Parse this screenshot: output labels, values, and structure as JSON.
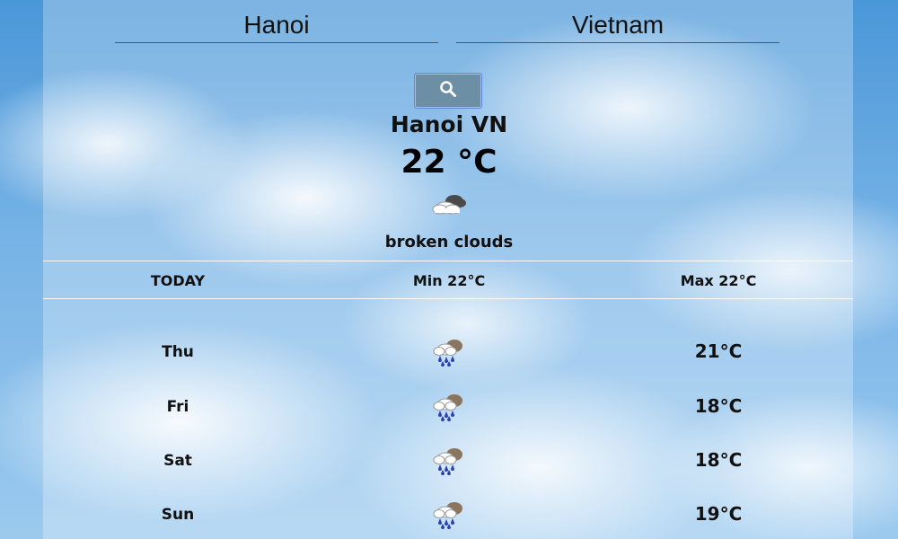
{
  "search": {
    "city_value": "Hanoi",
    "country_value": "Vietnam",
    "button_icon": "search-icon"
  },
  "current": {
    "location": "Hanoi VN",
    "temperature": "22 °C",
    "icon": "broken-clouds-icon",
    "description": "broken clouds"
  },
  "today": {
    "label": "TODAY",
    "min": "Min 22°C",
    "max": "Max 22°C"
  },
  "forecast": [
    {
      "day": "Thu",
      "icon": "rain-cloud-icon",
      "temp": "21°C"
    },
    {
      "day": "Fri",
      "icon": "rain-cloud-icon",
      "temp": "18°C"
    },
    {
      "day": "Sat",
      "icon": "rain-cloud-icon",
      "temp": "18°C"
    },
    {
      "day": "Sun",
      "icon": "rain-cloud-icon",
      "temp": "19°C"
    }
  ],
  "colors": {
    "search_button": "#6d8fa6",
    "search_button_border": "#5c87e6",
    "sky": "#77b3e6"
  }
}
